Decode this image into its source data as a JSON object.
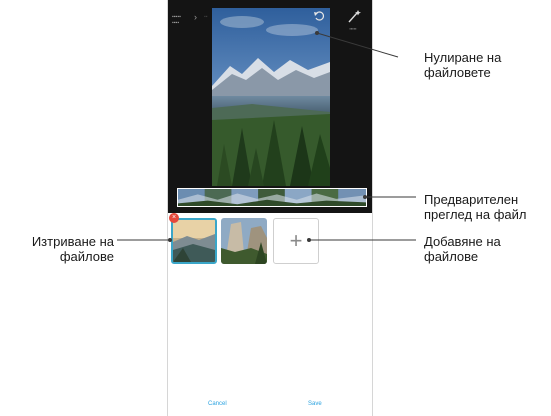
{
  "callouts": {
    "reset": "Нулиране на файловете",
    "preview": "Предварителен преглед на файл",
    "add": "Добавяне на файлове",
    "delete": "Изтриване на файлове"
  },
  "buttons": {
    "cancel": "Cancel",
    "save": "Save"
  },
  "icons": [
    "back-chevron-icon",
    "undo-icon",
    "magic-wand-icon",
    "plus-icon",
    "delete-badge-icon"
  ],
  "colors": {
    "accent": "#2ba3e0",
    "delete_badge": "#e5483b",
    "selected_border": "#3aa6c8"
  }
}
